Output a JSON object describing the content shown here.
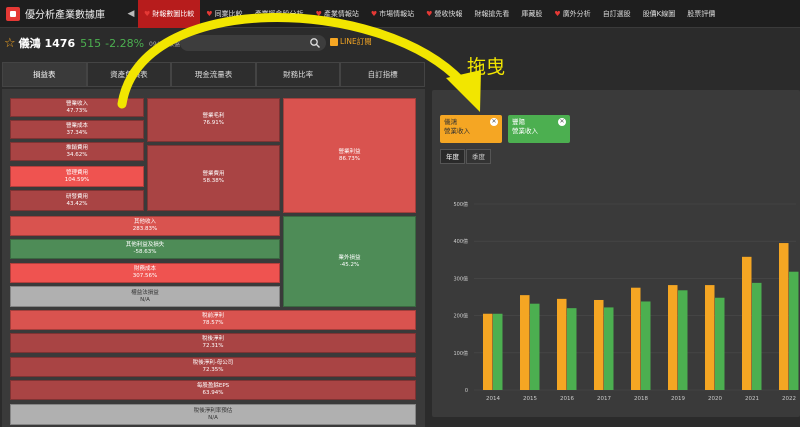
{
  "app": {
    "title": "優分析產業數據庫",
    "nav": [
      {
        "label": "財報數圖比較",
        "heart": true,
        "active": true
      },
      {
        "label": "同業比較",
        "heart": true,
        "active": false
      },
      {
        "label": "產業概念股分析",
        "heart": false,
        "active": false
      },
      {
        "label": "產業情報站",
        "heart": true,
        "active": false
      },
      {
        "label": "市場情報站",
        "heart": true,
        "active": false
      },
      {
        "label": "營收快報",
        "heart": true,
        "active": false
      },
      {
        "label": "財報搶先看",
        "heart": false,
        "active": false
      },
      {
        "label": "庫藏股",
        "heart": false,
        "active": false
      },
      {
        "label": "廣外分析",
        "heart": true,
        "active": false
      },
      {
        "label": "自訂選股",
        "heart": false,
        "active": false
      },
      {
        "label": "股價K線圖",
        "heart": false,
        "active": false
      },
      {
        "label": "股票評價",
        "heart": false,
        "active": false
      }
    ]
  },
  "stock": {
    "name": "儀鴻 1476",
    "price": "515",
    "change": "-2.28%",
    "date": "09/09 收盤價",
    "search_placeholder": "",
    "line_button": "LINE訂閱"
  },
  "tabs": [
    "損益表",
    "資產負債表",
    "現金流量表",
    "財務比率",
    "自訂指標"
  ],
  "treemap": [
    {
      "id": "tm-revenue",
      "label": "營業收入",
      "value": "47.73%"
    },
    {
      "id": "tm-cost",
      "label": "營業成本",
      "value": "37.34%"
    },
    {
      "id": "tm-selling",
      "label": "推銷費用",
      "value": "34.62%"
    },
    {
      "id": "tm-admin",
      "label": "管理費用",
      "value": "104.59%"
    },
    {
      "id": "tm-rnd",
      "label": "研發費用",
      "value": "43.42%"
    },
    {
      "id": "tm-gross",
      "label": "營業毛利",
      "value": "76.91%"
    },
    {
      "id": "tm-opex",
      "label": "營業費用",
      "value": "58.38%"
    },
    {
      "id": "tm-opincome",
      "label": "營業利益",
      "value": "86.73%"
    },
    {
      "id": "tm-otherinc",
      "label": "其他收入",
      "value": "283.83%"
    },
    {
      "id": "tm-othergain",
      "label": "其他利益及損失",
      "value": "-58.63%"
    },
    {
      "id": "tm-fincost",
      "label": "財務成本",
      "value": "307.56%"
    },
    {
      "id": "tm-equity",
      "label": "權益法損益",
      "value": "N/A"
    },
    {
      "id": "tm-nonop",
      "label": "業外損益",
      "value": "-45.2%"
    },
    {
      "id": "tm-pretax",
      "label": "稅前淨利",
      "value": "78.57%"
    },
    {
      "id": "tm-net",
      "label": "稅後淨利",
      "value": "72.31%"
    },
    {
      "id": "tm-netparent",
      "label": "稅後淨利-母公司",
      "value": "72.35%"
    },
    {
      "id": "tm-eps",
      "label": "每股盈餘EPS",
      "value": "63.94%"
    },
    {
      "id": "tm-extra",
      "label": "稅後淨利率預估",
      "value": "N/A"
    }
  ],
  "right_panel": {
    "chips": [
      {
        "company": "儀鴻",
        "metric": "營業收入",
        "color": "#f5a623"
      },
      {
        "company": "豐陽",
        "metric": "營業收入",
        "color": "#4caf50"
      }
    ],
    "periods": [
      {
        "label": "年度",
        "active": true
      },
      {
        "label": "季度",
        "active": false
      }
    ]
  },
  "annotation": {
    "label": "拖曳",
    "color": "#f2e600"
  },
  "chart_data": {
    "type": "bar",
    "categories": [
      "2014",
      "2015",
      "2016",
      "2017",
      "2018",
      "2019",
      "2020",
      "2021",
      "2022"
    ],
    "series": [
      {
        "values": [
          205,
          255,
          245,
          242,
          275,
          282,
          282,
          358,
          395
        ],
        "color": "#f5a623"
      },
      {
        "values": [
          205,
          232,
          220,
          222,
          238,
          268,
          248,
          288,
          318
        ],
        "color": "#4caf50"
      }
    ],
    "y_ticks": [
      "0",
      "100億",
      "200億",
      "300億",
      "400億",
      "500億"
    ],
    "ylim": [
      0,
      500
    ]
  }
}
